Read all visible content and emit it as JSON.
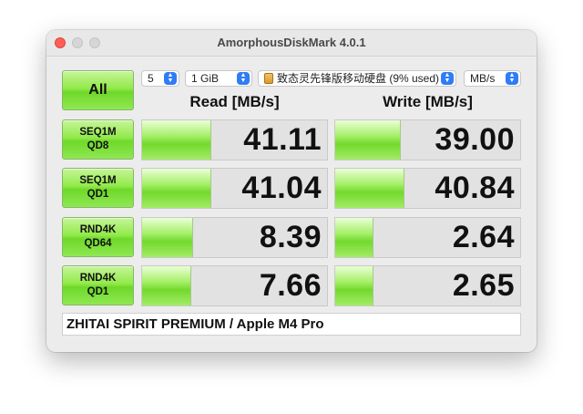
{
  "window": {
    "title": "AmorphousDiskMark 4.0.1"
  },
  "controls": {
    "all_label": "All",
    "count_value": "5",
    "size_value": "1 GiB",
    "disk_value": "致态灵先锋版移动硬盘 (9% used)",
    "unit_value": "MB/s"
  },
  "headers": {
    "read": "Read [MB/s]",
    "write": "Write [MB/s]"
  },
  "tests": [
    {
      "line1": "SEQ1M",
      "line2": "QD8",
      "read": "41.11",
      "write": "39.00",
      "read_fill": 0.37,
      "write_fill": 0.35
    },
    {
      "line1": "SEQ1M",
      "line2": "QD1",
      "read": "41.04",
      "write": "40.84",
      "read_fill": 0.37,
      "write_fill": 0.37
    },
    {
      "line1": "RND4K",
      "line2": "QD64",
      "read": "8.39",
      "write": "2.64",
      "read_fill": 0.27,
      "write_fill": 0.2
    },
    {
      "line1": "RND4K",
      "line2": "QD1",
      "read": "7.66",
      "write": "2.65",
      "read_fill": 0.26,
      "write_fill": 0.2
    }
  ],
  "comment": "ZHITAI SPIRIT PREMIUM / Apple M4 Pro",
  "colors": {
    "accent_green": "#7fdf3a",
    "close_red": "#ff5f57",
    "stepper_blue": "#2f7cf6"
  },
  "icons": {
    "disk": "external-disk-icon",
    "stepper": "up-down-stepper-icon"
  }
}
